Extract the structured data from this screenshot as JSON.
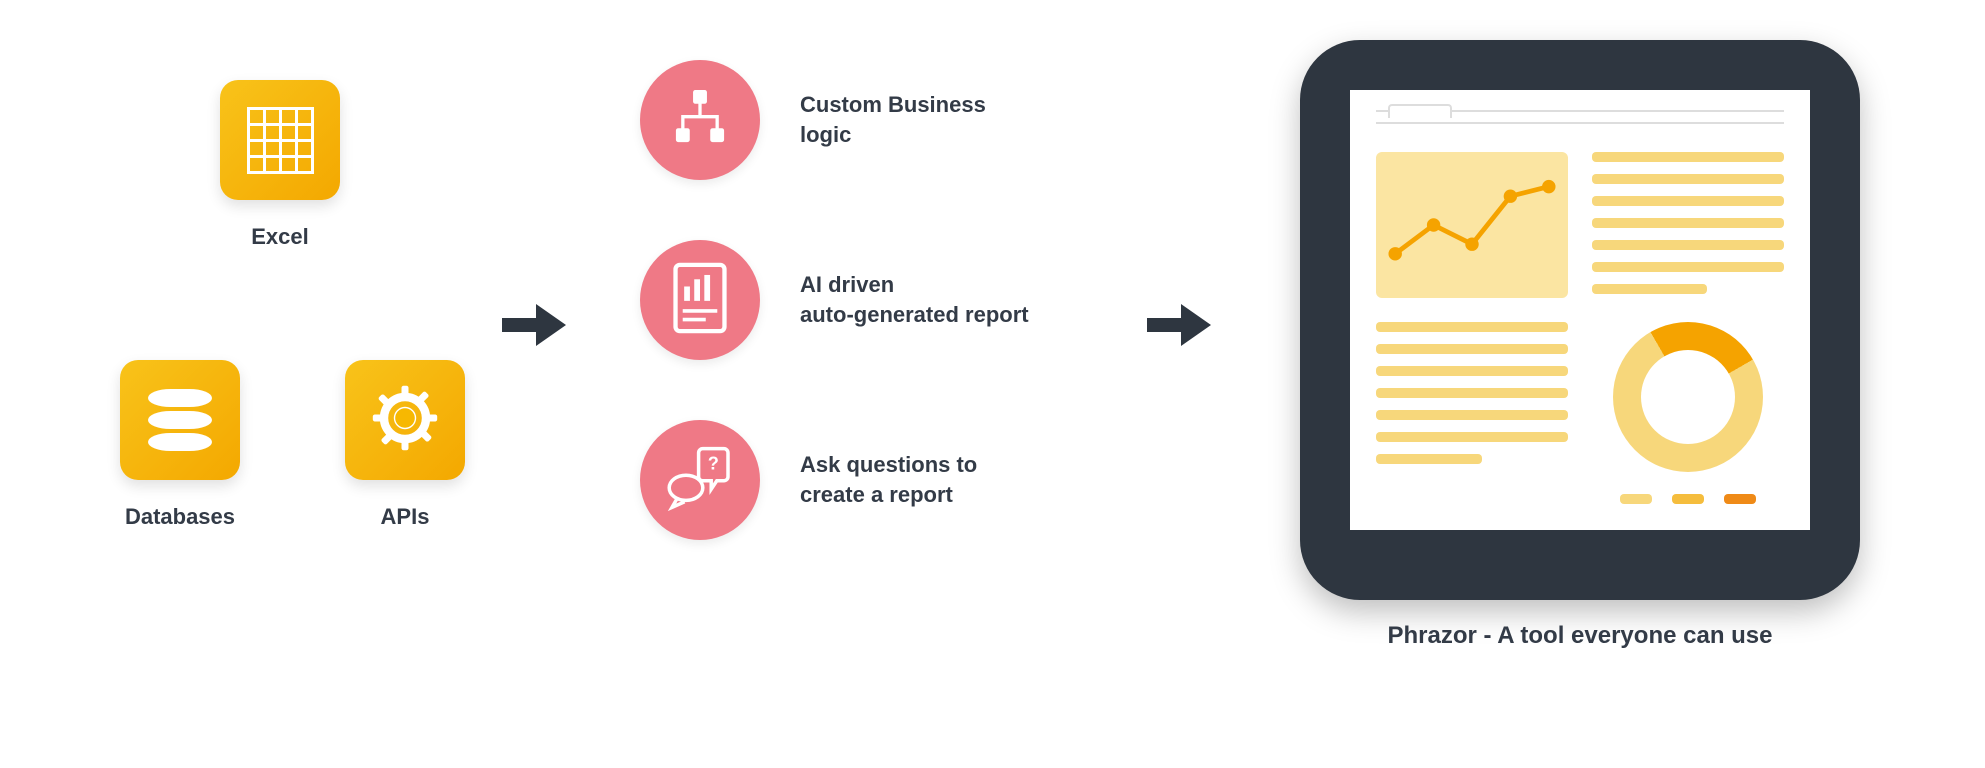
{
  "sources": {
    "excel": {
      "label": "Excel",
      "icon": "grid-icon"
    },
    "databases": {
      "label": "Databases",
      "icon": "database-icon"
    },
    "apis": {
      "label": "APIs",
      "icon": "gear-icon"
    }
  },
  "steps": [
    {
      "icon": "hierarchy-icon",
      "text": "Custom Business\nlogic"
    },
    {
      "icon": "barchart-doc-icon",
      "text": "AI driven\nauto-generated report"
    },
    {
      "icon": "question-chat-icon",
      "text": "Ask questions to\ncreate a report"
    }
  ],
  "output": {
    "caption": "Phrazor - A tool everyone can use"
  },
  "colors": {
    "tile": "#f7b801",
    "circle": "#ef7986",
    "text": "#333b47",
    "device": "#2e3640",
    "accent_light": "#f7d77b",
    "accent_dark": "#f5a300"
  }
}
